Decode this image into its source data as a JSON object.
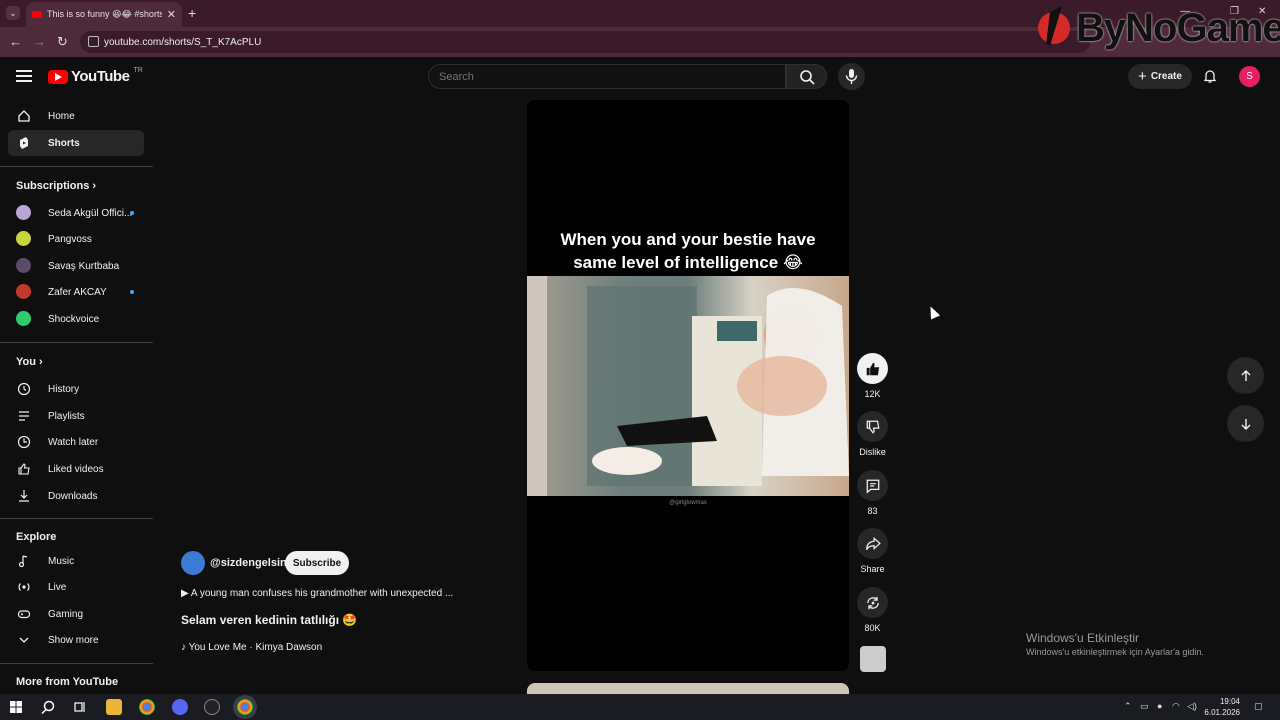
{
  "browser": {
    "tab_title": "This is so funny 😆😂 #shorts",
    "tab_close": "✕",
    "new_tab": "+",
    "url": "youtube.com/shorts/S_T_K7AcPLU",
    "watermark": "ByNoGame"
  },
  "header": {
    "logo_text": "YouTube",
    "region": "TR",
    "search_placeholder": "Search",
    "create_label": "Create",
    "avatar_letter": "S"
  },
  "sidebar": {
    "home": "Home",
    "shorts": "Shorts",
    "subscriptions_heading": "Subscriptions",
    "subscriptions": [
      {
        "name": "Seda Akgül Offici...",
        "color": "#b9a6d6",
        "new": true
      },
      {
        "name": "Pangvoss",
        "color": "#c9d63a",
        "new": false
      },
      {
        "name": "Savaş Kurtbaba",
        "color": "#5b4c6b",
        "new": false
      },
      {
        "name": "Zafer AKCAY",
        "color": "#c0392b",
        "new": true
      },
      {
        "name": "Shockvoice",
        "color": "#2ecc71",
        "new": false
      }
    ],
    "you_heading": "You",
    "you_items": [
      "History",
      "Playlists",
      "Watch later",
      "Liked videos",
      "Downloads"
    ],
    "explore_heading": "Explore",
    "explore_items": [
      "Music",
      "Live",
      "Gaming",
      "Show more"
    ],
    "more_heading": "More from YouTube"
  },
  "video": {
    "caption_line1": "When you and your bestie have",
    "caption_line2": "same level of intelligence 😂",
    "handle": "@girlglowmax",
    "channel": "@sizdengelsin",
    "subscribe": "Subscribe",
    "description": "▶  A young man confuses his grandmother with unexpected ...",
    "title": "Selam veren kedinin tatlılığı 🤩",
    "music": "♪ You Love Me · Kimya Dawson"
  },
  "actions": {
    "likes": "12K",
    "dislike": "Dislike",
    "comments": "83",
    "share": "Share",
    "remix": "80K"
  },
  "windows": {
    "activate_title": "Windows'u Etkinleştir",
    "activate_sub": "Windows'u etkinleştirmek için Ayarlar'a gidin.",
    "time": "19:04",
    "date": "6.01.2026"
  }
}
